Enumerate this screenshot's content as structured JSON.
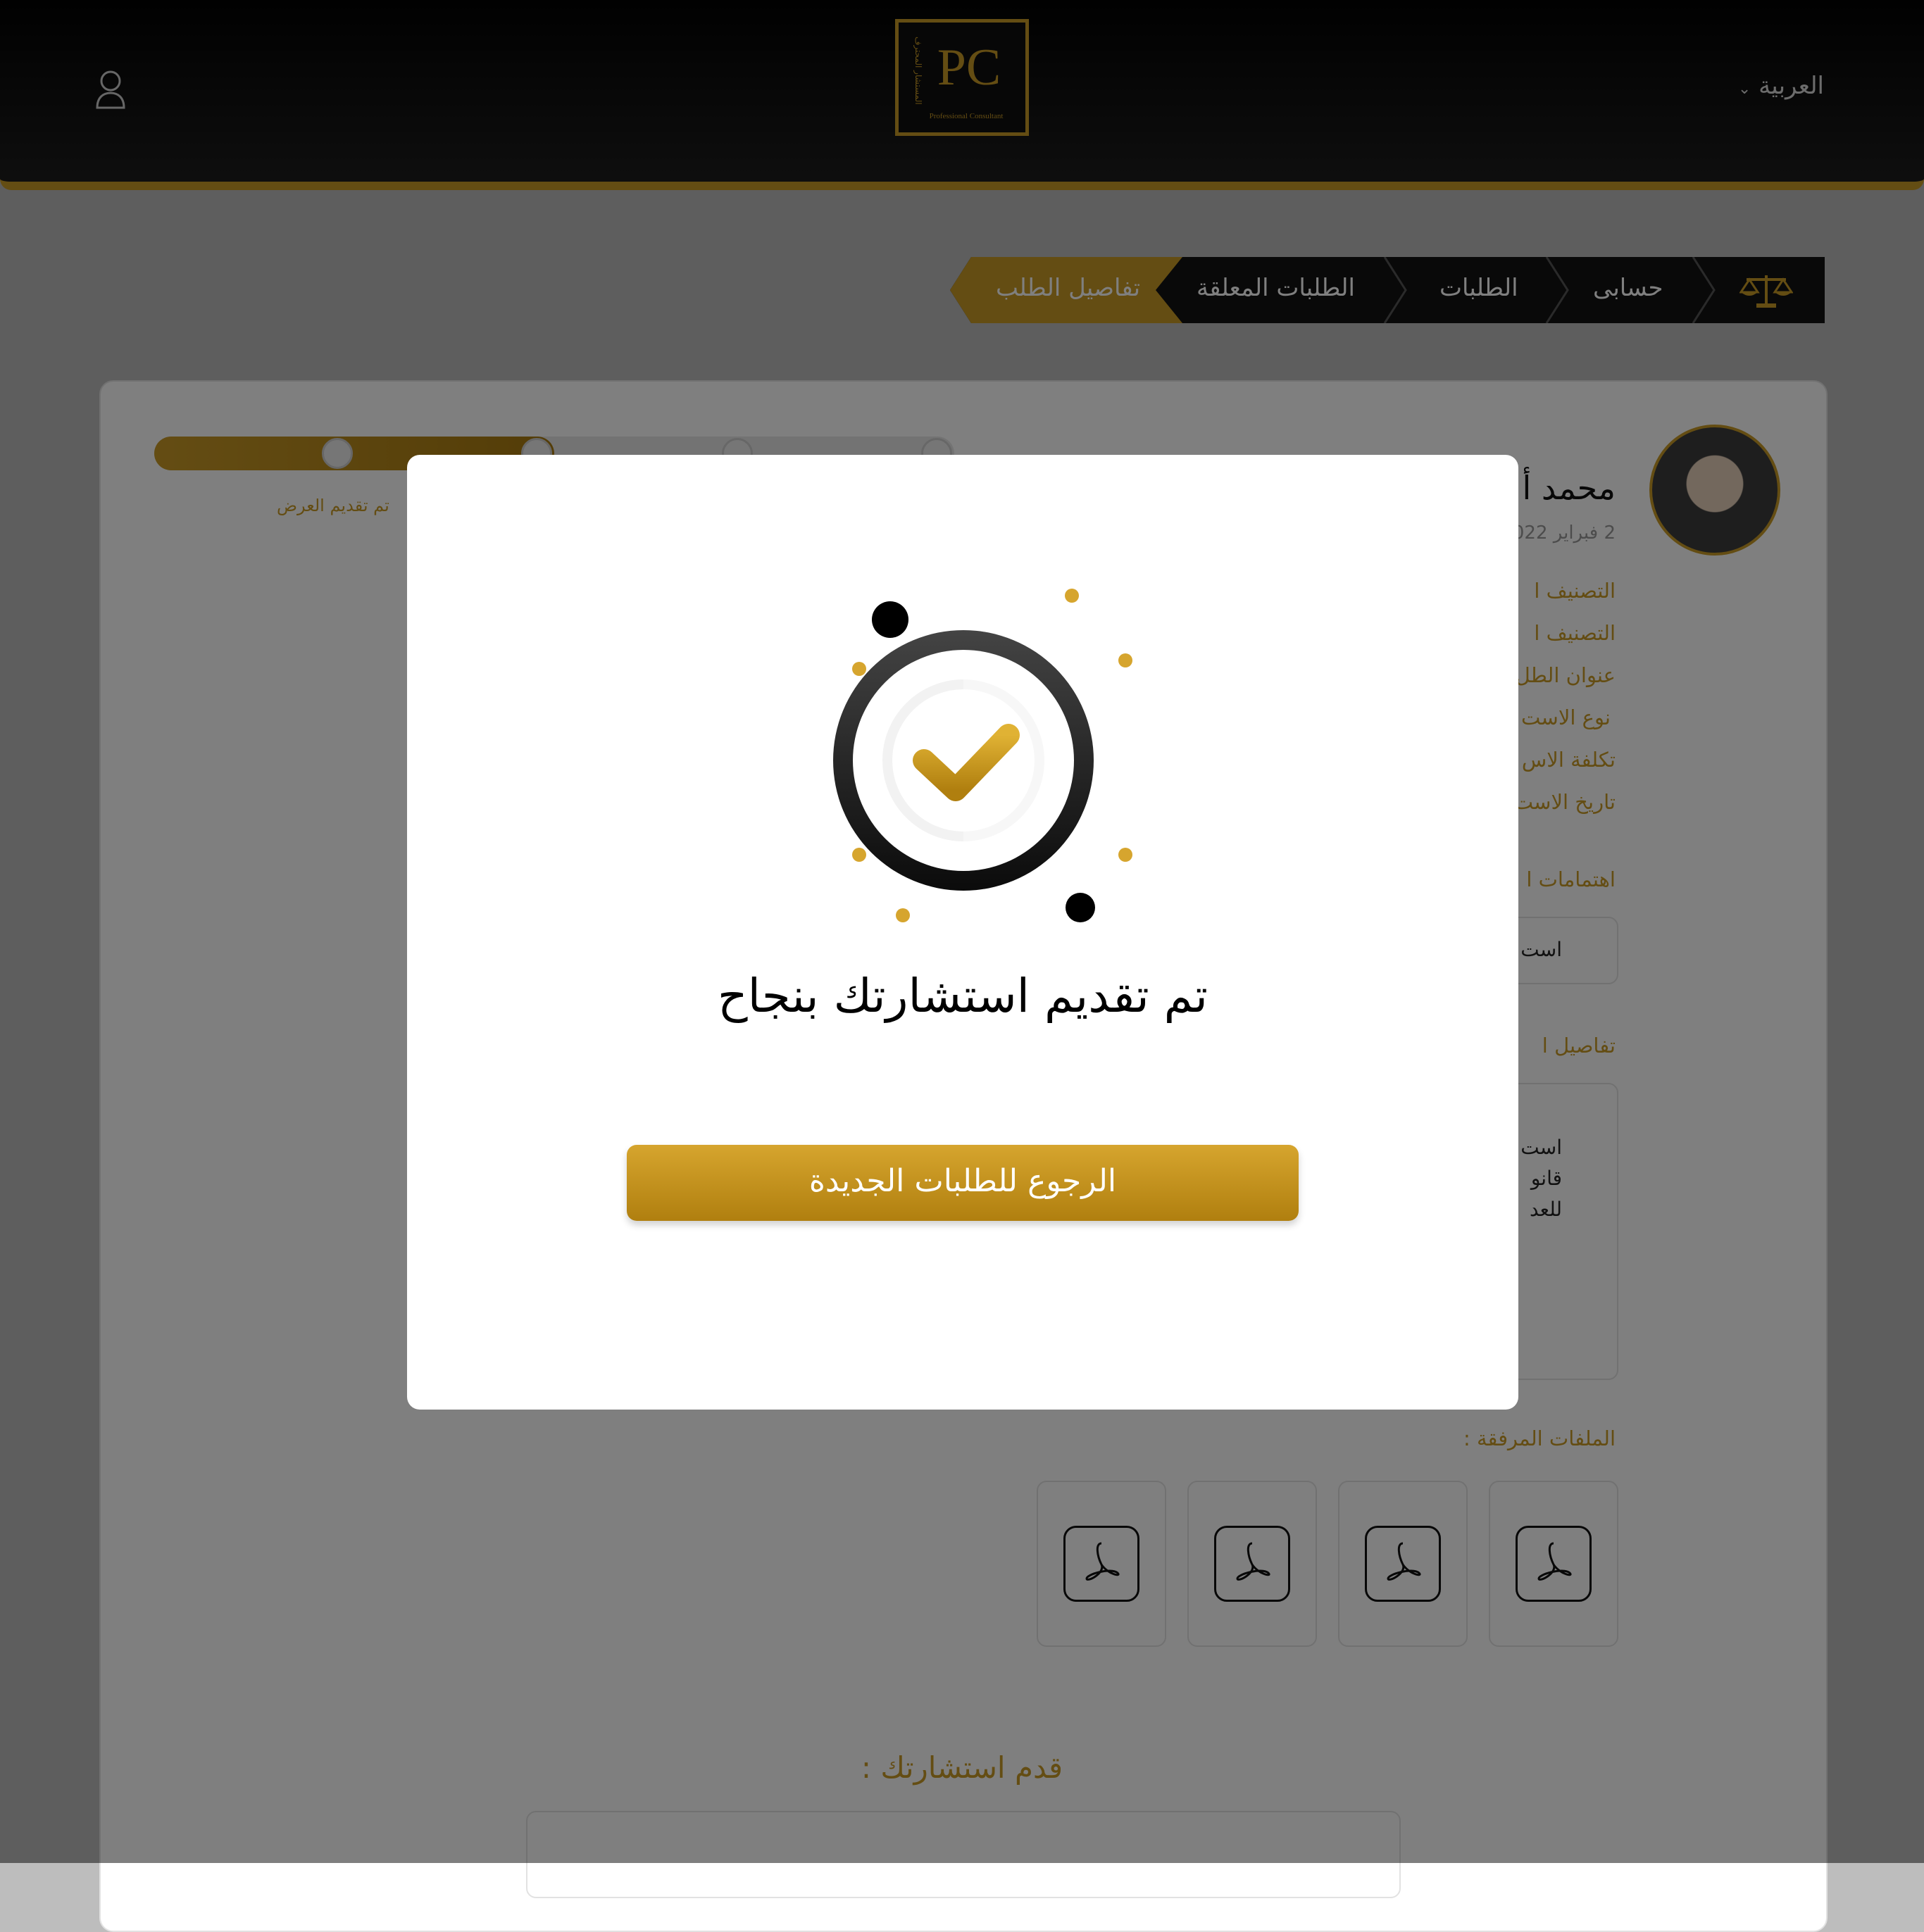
{
  "header": {
    "language": "العربية",
    "logo_caption": "Professional Consultant",
    "logo_letters": "PC",
    "logo_arabic": "المستشار المحترف"
  },
  "breadcrumb": {
    "items": [
      "حسابى",
      "الطلبات",
      "الطلبات المعلقة"
    ],
    "current": "تفاصيل الطلب"
  },
  "request": {
    "client_name": "محمد أ",
    "date": "2 فبراير 2022",
    "fields": [
      "التصنيف ا",
      "التصنيف ا",
      "عنوان الطل",
      "نوع الاست",
      "تكلفة الاس",
      "تاريخ الاست"
    ],
    "interests_label": "اهتمامات ا",
    "interest_chip": "است",
    "details_label": "تفاصيل ا",
    "details_lines": [
      "است",
      "قانو",
      "للعد"
    ],
    "attachments_label": "الملفات المرفقة :",
    "submit_label": "قدم استشارتك :",
    "progress": {
      "fraction": 0.5,
      "step_label": "تم تقديم العرض"
    }
  },
  "modal": {
    "title": "تم تقديم استشارتك بنجاح",
    "button_label": "الرجوع للطلبات الجديدة"
  },
  "colors": {
    "gold": "#c99a27",
    "header_bg": "#0b0b0b",
    "overlay": "rgba(0,0,0,0.5)"
  }
}
